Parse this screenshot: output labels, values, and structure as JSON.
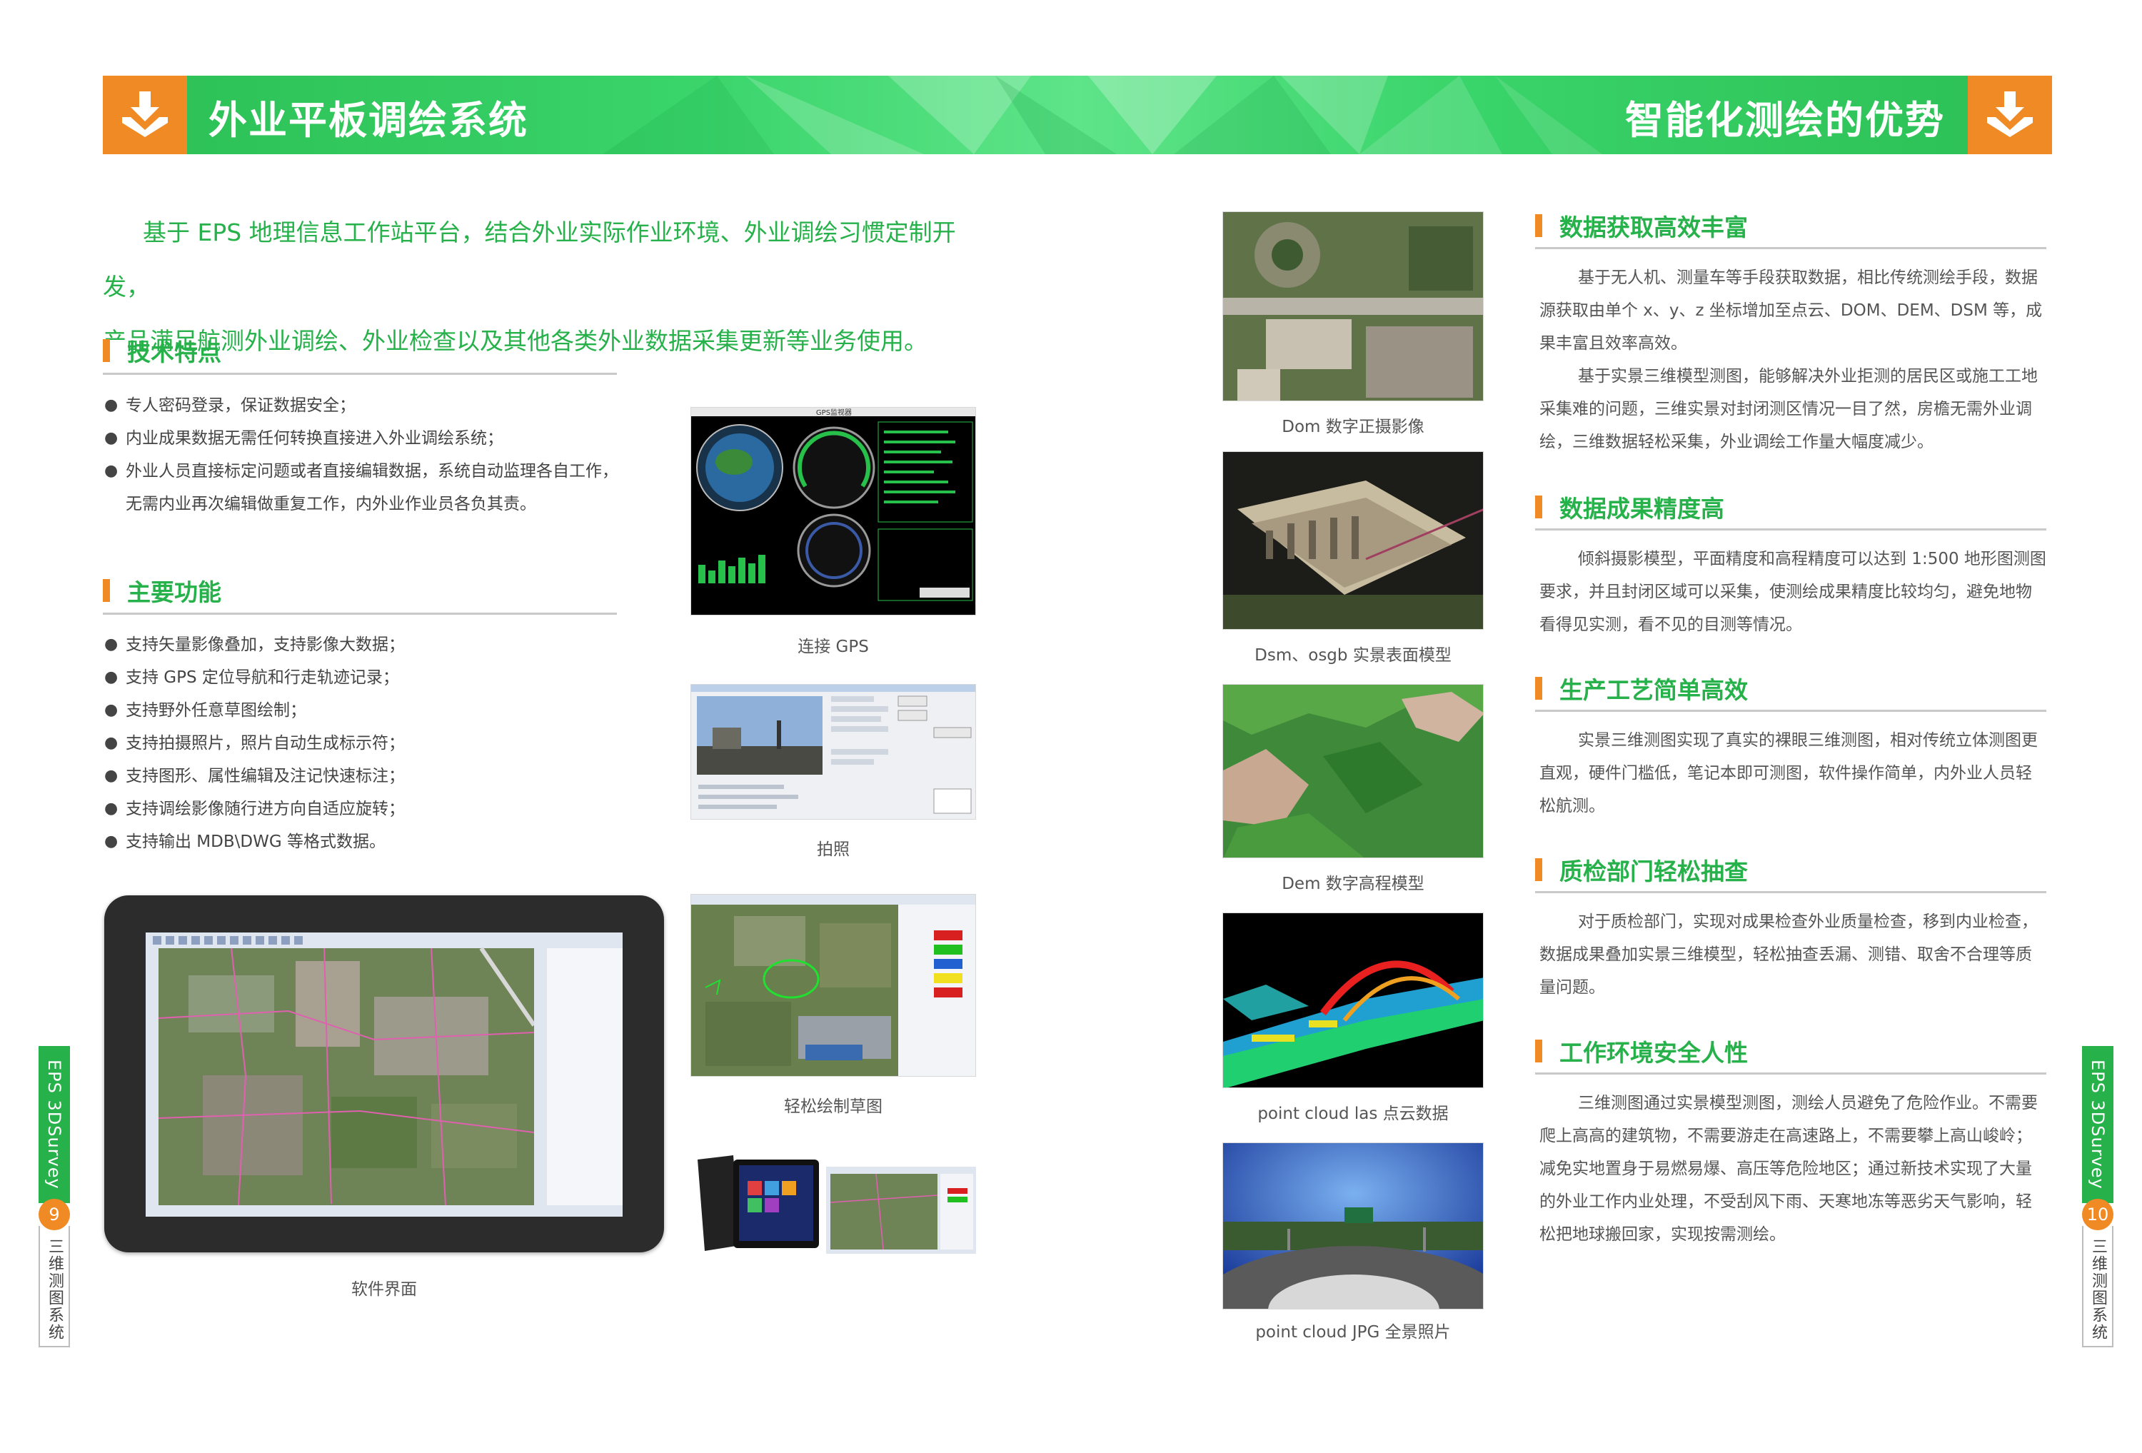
{
  "header": {
    "left_title": "外业平板调绘系统",
    "right_title": "智能化测绘的优势",
    "brand_color": "#2cbf55",
    "accent_color": "#f08a24",
    "icon": "download-tray-icon"
  },
  "intro": {
    "line1": "基于 EPS 地理信息工作站平台，结合外业实际作业环境、外业调绘习惯定制开发，",
    "line2": "产品满足航测外业调绘、外业检查以及其他各类外业数据采集更新等业务使用。"
  },
  "tech_features": {
    "title": "技术特点",
    "items": [
      "专人密码登录，保证数据安全；",
      "内业成果数据无需任何转换直接进入外业调绘系统；",
      "外业人员直接标定问题或者直接编辑数据，系统自动监理各自工作，",
      "无需内业再次编辑做重复工作，内外业作业员各负其责。"
    ]
  },
  "main_functions": {
    "title": "主要功能",
    "items": [
      "支持矢量影像叠加，支持影像大数据；",
      "支持 GPS 定位导航和行走轨迹记录；",
      "支持野外任意草图绘制；",
      "支持拍摄照片，照片自动生成标示符；",
      "支持图形、属性编辑及注记快速标注；",
      "支持调绘影像随行进方向自适应旋转；",
      "支持输出 MDB\\DWG 等格式数据。"
    ]
  },
  "figures_left": {
    "tablet_caption": "软件界面",
    "gps_caption": "连接 GPS",
    "gps_window_title": "GPS监视器",
    "photo_caption": "拍照",
    "sketch_caption": "轻松绘制草图"
  },
  "figures_right": {
    "dom_caption": "Dom 数字正摄影像",
    "dsm_caption": "Dsm、osgb 实景表面模型",
    "dem_caption": "Dem 数字高程模型",
    "las_caption": "point cloud las 点云数据",
    "jpg_caption": "point cloud JPG 全景照片"
  },
  "advantages": [
    {
      "title": "数据获取高效丰富",
      "paragraphs": [
        "基于无人机、测量车等手段获取数据，相比传统测绘手段，数据源获取由单个 x、y、z 坐标增加至点云、DOM、DEM、DSM 等，成果丰富且效率高效。",
        "基于实景三维模型测图，能够解决外业拒测的居民区或施工工地采集难的问题，三维实景对封闭测区情况一目了然，房檐无需外业调绘，三维数据轻松采集，外业调绘工作量大幅度减少。"
      ]
    },
    {
      "title": "数据成果精度高",
      "paragraphs": [
        "倾斜摄影模型，平面精度和高程精度可以达到 1:500 地形图测图要求，并且封闭区域可以采集，使测绘成果精度比较均匀，避免地物看得见实测，看不见的目测等情况。"
      ]
    },
    {
      "title": "生产工艺简单高效",
      "paragraphs": [
        "实景三维测图实现了真实的裸眼三维测图，相对传统立体测图更直观，硬件门槛低，笔记本即可测图，软件操作简单，内外业人员轻松航测。"
      ]
    },
    {
      "title": "质检部门轻松抽查",
      "paragraphs": [
        "对于质检部门，实现对成果检查外业质量检查，移到内业检查，数据成果叠加实景三维模型，轻松抽查丢漏、测错、取舍不合理等质量问题。"
      ]
    },
    {
      "title": "工作环境安全人性",
      "paragraphs": [
        "三维测图通过实景模型测图，测绘人员避免了危险作业。不需要爬上高高的建筑物，不需要游走在高速路上，不需要攀上高山峻岭；减免实地置身于易燃易爆、高压等危险地区；通过新技术实现了大量的外业工作内业处理，不受刮风下雨、天寒地冻等恶劣天气影响，轻松把地球搬回家，实现按需测绘。"
      ]
    }
  ],
  "side_tabs": {
    "left": {
      "product": "EPS 3DSurvey",
      "page": "9",
      "system": "三维测图系统"
    },
    "right": {
      "product": "EPS 3DSurvey",
      "page": "10",
      "system": "三维测图系统"
    }
  }
}
